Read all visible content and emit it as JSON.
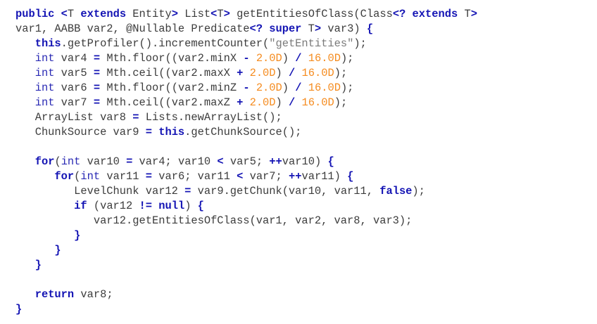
{
  "colors": {
    "keyword": "#1414b4",
    "identifier": "#3c3c3c",
    "number": "#f58c20",
    "string": "#7a7a7a",
    "background": "#ffffff"
  },
  "code": {
    "lines": [
      [
        [
          "kw",
          "public"
        ],
        [
          "id",
          " "
        ],
        [
          "op",
          "<"
        ],
        [
          "id",
          "T "
        ],
        [
          "kw",
          "extends"
        ],
        [
          "id",
          " Entity"
        ],
        [
          "op",
          ">"
        ],
        [
          "id",
          " List"
        ],
        [
          "op",
          "<"
        ],
        [
          "id",
          "T"
        ],
        [
          "op",
          ">"
        ],
        [
          "id",
          " getEntitiesOfClass(Class"
        ],
        [
          "op",
          "<?"
        ],
        [
          "id",
          " "
        ],
        [
          "kw",
          "extends"
        ],
        [
          "id",
          " T"
        ],
        [
          "op",
          ">"
        ]
      ],
      [
        [
          "id",
          "var1, AABB var2, @Nullable Predicate"
        ],
        [
          "op",
          "<?"
        ],
        [
          "id",
          " "
        ],
        [
          "kw",
          "super"
        ],
        [
          "id",
          " T"
        ],
        [
          "op",
          ">"
        ],
        [
          "id",
          " var3) "
        ],
        [
          "op",
          "{"
        ]
      ],
      [
        [
          "id",
          "   "
        ],
        [
          "kw",
          "this"
        ],
        [
          "id",
          ".getProfiler().incrementCounter("
        ],
        [
          "str",
          "\"getEntities\""
        ],
        [
          "id",
          ");"
        ]
      ],
      [
        [
          "id",
          "   "
        ],
        [
          "ty",
          "int"
        ],
        [
          "id",
          " var4 "
        ],
        [
          "op",
          "="
        ],
        [
          "id",
          " Mth.floor((var2.minX "
        ],
        [
          "op",
          "-"
        ],
        [
          "id",
          " "
        ],
        [
          "num",
          "2.0D"
        ],
        [
          "id",
          ") "
        ],
        [
          "op",
          "/"
        ],
        [
          "id",
          " "
        ],
        [
          "num",
          "16.0D"
        ],
        [
          "id",
          ");"
        ]
      ],
      [
        [
          "id",
          "   "
        ],
        [
          "ty",
          "int"
        ],
        [
          "id",
          " var5 "
        ],
        [
          "op",
          "="
        ],
        [
          "id",
          " Mth.ceil((var2.maxX "
        ],
        [
          "op",
          "+"
        ],
        [
          "id",
          " "
        ],
        [
          "num",
          "2.0D"
        ],
        [
          "id",
          ") "
        ],
        [
          "op",
          "/"
        ],
        [
          "id",
          " "
        ],
        [
          "num",
          "16.0D"
        ],
        [
          "id",
          ");"
        ]
      ],
      [
        [
          "id",
          "   "
        ],
        [
          "ty",
          "int"
        ],
        [
          "id",
          " var6 "
        ],
        [
          "op",
          "="
        ],
        [
          "id",
          " Mth.floor((var2.minZ "
        ],
        [
          "op",
          "-"
        ],
        [
          "id",
          " "
        ],
        [
          "num",
          "2.0D"
        ],
        [
          "id",
          ") "
        ],
        [
          "op",
          "/"
        ],
        [
          "id",
          " "
        ],
        [
          "num",
          "16.0D"
        ],
        [
          "id",
          ");"
        ]
      ],
      [
        [
          "id",
          "   "
        ],
        [
          "ty",
          "int"
        ],
        [
          "id",
          " var7 "
        ],
        [
          "op",
          "="
        ],
        [
          "id",
          " Mth.ceil((var2.maxZ "
        ],
        [
          "op",
          "+"
        ],
        [
          "id",
          " "
        ],
        [
          "num",
          "2.0D"
        ],
        [
          "id",
          ") "
        ],
        [
          "op",
          "/"
        ],
        [
          "id",
          " "
        ],
        [
          "num",
          "16.0D"
        ],
        [
          "id",
          ");"
        ]
      ],
      [
        [
          "id",
          "   ArrayList var8 "
        ],
        [
          "op",
          "="
        ],
        [
          "id",
          " Lists.newArrayList();"
        ]
      ],
      [
        [
          "id",
          "   ChunkSource var9 "
        ],
        [
          "op",
          "="
        ],
        [
          "id",
          " "
        ],
        [
          "kw",
          "this"
        ],
        [
          "id",
          ".getChunkSource();"
        ]
      ],
      [
        [
          "id",
          ""
        ]
      ],
      [
        [
          "id",
          "   "
        ],
        [
          "kw",
          "for"
        ],
        [
          "id",
          "("
        ],
        [
          "ty",
          "int"
        ],
        [
          "id",
          " var10 "
        ],
        [
          "op",
          "="
        ],
        [
          "id",
          " var4; var10 "
        ],
        [
          "op",
          "<"
        ],
        [
          "id",
          " var5; "
        ],
        [
          "op",
          "++"
        ],
        [
          "id",
          "var10) "
        ],
        [
          "op",
          "{"
        ]
      ],
      [
        [
          "id",
          "      "
        ],
        [
          "kw",
          "for"
        ],
        [
          "id",
          "("
        ],
        [
          "ty",
          "int"
        ],
        [
          "id",
          " var11 "
        ],
        [
          "op",
          "="
        ],
        [
          "id",
          " var6; var11 "
        ],
        [
          "op",
          "<"
        ],
        [
          "id",
          " var7; "
        ],
        [
          "op",
          "++"
        ],
        [
          "id",
          "var11) "
        ],
        [
          "op",
          "{"
        ]
      ],
      [
        [
          "id",
          "         LevelChunk var12 "
        ],
        [
          "op",
          "="
        ],
        [
          "id",
          " var9.getChunk(var10, var11, "
        ],
        [
          "kw",
          "false"
        ],
        [
          "id",
          ");"
        ]
      ],
      [
        [
          "id",
          "         "
        ],
        [
          "kw",
          "if"
        ],
        [
          "id",
          " (var12 "
        ],
        [
          "op",
          "!="
        ],
        [
          "id",
          " "
        ],
        [
          "kw",
          "null"
        ],
        [
          "id",
          ") "
        ],
        [
          "op",
          "{"
        ]
      ],
      [
        [
          "id",
          "            var12.getEntitiesOfClass(var1, var2, var8, var3);"
        ]
      ],
      [
        [
          "id",
          "         "
        ],
        [
          "op",
          "}"
        ]
      ],
      [
        [
          "id",
          "      "
        ],
        [
          "op",
          "}"
        ]
      ],
      [
        [
          "id",
          "   "
        ],
        [
          "op",
          "}"
        ]
      ],
      [
        [
          "id",
          ""
        ]
      ],
      [
        [
          "id",
          "   "
        ],
        [
          "kw",
          "return"
        ],
        [
          "id",
          " var8;"
        ]
      ],
      [
        [
          "op",
          "}"
        ]
      ]
    ]
  }
}
